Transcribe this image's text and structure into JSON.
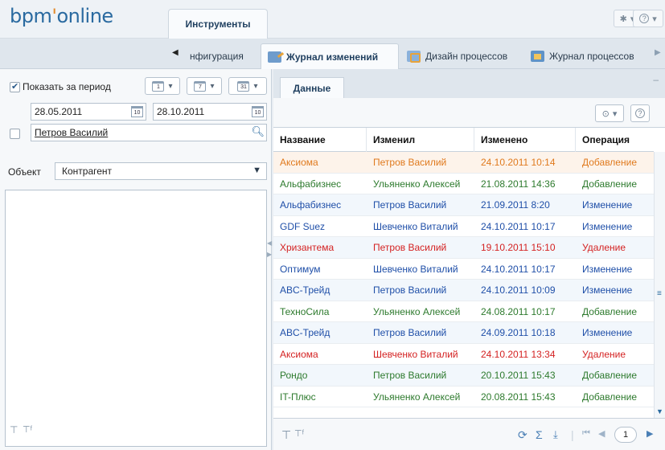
{
  "header": {
    "logo_main": "bpm",
    "logo_apos": "'",
    "logo_rest": "online",
    "main_tab": "Инструменты",
    "gear_icon": "gear-icon",
    "help_icon": "help-icon"
  },
  "subtabs": {
    "partial": "нфигурация",
    "items": [
      {
        "label": "Журнал изменений",
        "icon": "change-log-icon",
        "active": true
      },
      {
        "label": "Дизайн процессов",
        "icon": "process-design-icon",
        "active": false
      },
      {
        "label": "Журнал процессов",
        "icon": "process-log-icon",
        "active": false
      }
    ]
  },
  "filter": {
    "period_label": "Показать за период",
    "period_checked": true,
    "period_buttons": [
      "1",
      "7",
      "31"
    ],
    "date_from": "28.05.2011",
    "date_to": "28.10.2011",
    "user_value": "Петров Василий",
    "user_checked": false,
    "object_label": "Объект",
    "object_value": "Контрагент"
  },
  "data_panel": {
    "tab_label": "Данные",
    "minimize_glyph": "–"
  },
  "grid": {
    "columns": [
      "Название",
      "Изменил",
      "Изменено",
      "Операция"
    ],
    "rows": [
      {
        "name": "Аксиома",
        "user": "Петров Василий",
        "date": "24.10.2011 10:14",
        "op": "Добавление",
        "color": "#e07a1e",
        "selected": true
      },
      {
        "name": "Альфабизнес",
        "user": "Ульяненко Алексей",
        "date": "21.08.2011 14:36",
        "op": "Добавление",
        "color": "#2d7a2d"
      },
      {
        "name": "Альфабизнес",
        "user": "Петров Василий",
        "date": "21.09.2011 8:20",
        "op": "Изменение",
        "color": "#1f4fa8"
      },
      {
        "name": "GDF Suez",
        "user": "Шевченко Виталий",
        "date": "24.10.2011 10:17",
        "op": "Изменение",
        "color": "#1f4fa8"
      },
      {
        "name": "Хризантема",
        "user": "Петров Василий",
        "date": "19.10.2011 15:10",
        "op": "Удаление",
        "color": "#d42222"
      },
      {
        "name": "Оптимум",
        "user": "Шевченко Виталий",
        "date": "24.10.2011 10:17",
        "op": "Изменение",
        "color": "#1f4fa8"
      },
      {
        "name": "ABC-Трейд",
        "user": "Петров Василий",
        "date": "24.10.2011 10:09",
        "op": "Изменение",
        "color": "#1f4fa8"
      },
      {
        "name": "ТехноСила",
        "user": "Ульяненко Алексей",
        "date": "24.08.2011 10:17",
        "op": "Добавление",
        "color": "#2d7a2d"
      },
      {
        "name": "ABC-Трейд",
        "user": "Петров Василий",
        "date": "24.09.2011 10:18",
        "op": "Изменение",
        "color": "#1f4fa8"
      },
      {
        "name": "Аксиома",
        "user": "Шевченко Виталий",
        "date": "24.10.2011 13:34",
        "op": "Удаление",
        "color": "#d42222"
      },
      {
        "name": "Рондо",
        "user": "Петров Василий",
        "date": "20.10.2011 15:43",
        "op": "Добавление",
        "color": "#2d7a2d"
      },
      {
        "name": "IT-Плюс",
        "user": "Ульяненко Алексей",
        "date": "20.08.2011 15:43",
        "op": "Добавление",
        "color": "#2d7a2d"
      }
    ]
  },
  "footer": {
    "page": "1"
  }
}
